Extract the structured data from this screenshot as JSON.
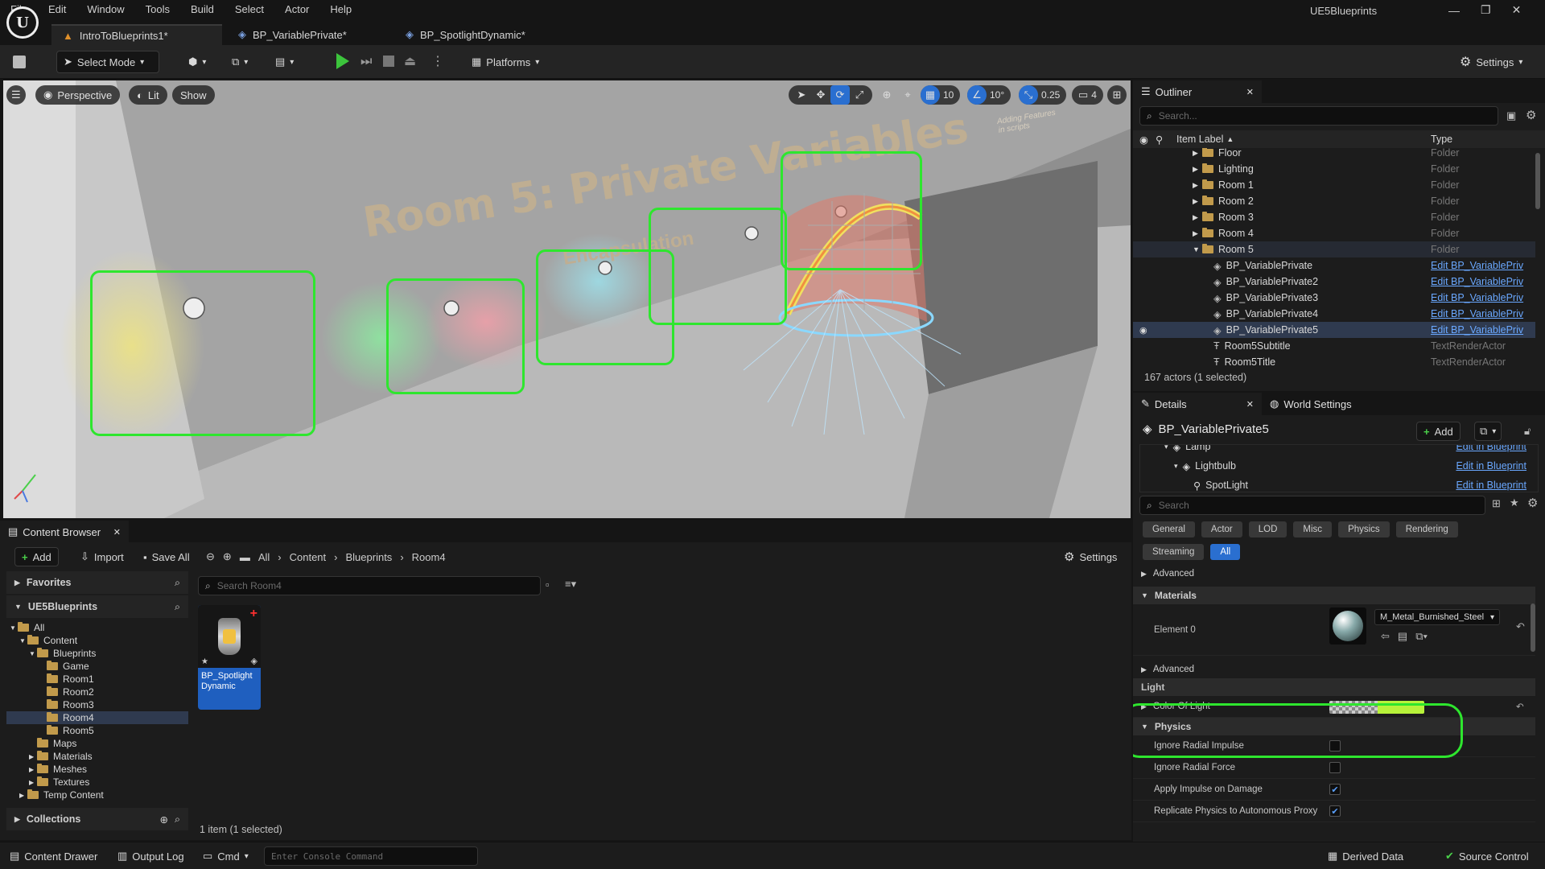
{
  "app": {
    "name": "UE5Blueprints"
  },
  "menu": [
    "File",
    "Edit",
    "Window",
    "Tools",
    "Build",
    "Select",
    "Actor",
    "Help"
  ],
  "doc_tabs": [
    {
      "label": "IntroToBlueprints1*",
      "active": true
    },
    {
      "label": "BP_VariablePrivate*",
      "active": false
    },
    {
      "label": "BP_SpotlightDynamic*",
      "active": false
    }
  ],
  "toolbar": {
    "select_mode": "Select Mode",
    "platforms": "Platforms",
    "settings": "Settings"
  },
  "viewport": {
    "perspective": "Perspective",
    "lit": "Lit",
    "show": "Show",
    "grid_snap": "10",
    "rot_snap": "10°",
    "scale_snap": "0.25",
    "camera_speed": "4",
    "scene_title": "Room 5: Private Variables",
    "scene_subtitle": "Encapsulation",
    "scene_note_1": "Adding Features",
    "scene_note_2": "in scripts"
  },
  "outliner": {
    "tab": "Outliner",
    "search_placeholder": "Search...",
    "col_label": "Item Label",
    "col_type": "Type",
    "rows": [
      {
        "label": "Floor",
        "type": "Folder"
      },
      {
        "label": "Lighting",
        "type": "Folder"
      },
      {
        "label": "Room 1",
        "type": "Folder"
      },
      {
        "label": "Room 2",
        "type": "Folder"
      },
      {
        "label": "Room 3",
        "type": "Folder"
      },
      {
        "label": "Room 4",
        "type": "Folder"
      },
      {
        "label": "Room 5",
        "type": "Folder"
      },
      {
        "label": "BP_VariablePrivate",
        "type": "Edit BP_VariablePriv"
      },
      {
        "label": "BP_VariablePrivate2",
        "type": "Edit BP_VariablePriv"
      },
      {
        "label": "BP_VariablePrivate3",
        "type": "Edit BP_VariablePriv"
      },
      {
        "label": "BP_VariablePrivate4",
        "type": "Edit BP_VariablePriv"
      },
      {
        "label": "BP_VariablePrivate5",
        "type": "Edit BP_VariablePriv"
      },
      {
        "label": "Room5Subtitle",
        "type": "TextRenderActor"
      },
      {
        "label": "Room5Title",
        "type": "TextRenderActor"
      }
    ],
    "footer": "167 actors (1 selected)"
  },
  "details": {
    "tab": "Details",
    "world_tab": "World Settings",
    "actor_name": "BP_VariablePrivate5",
    "add": "Add",
    "components": [
      {
        "label": "Lamp",
        "link": "Edit in Blueprint"
      },
      {
        "label": "Lightbulb",
        "link": "Edit in Blueprint"
      },
      {
        "label": "SpotLight",
        "link": "Edit in Blueprint"
      }
    ],
    "search_placeholder": "Search",
    "filters": [
      "General",
      "Actor",
      "LOD",
      "Misc",
      "Physics",
      "Rendering",
      "Streaming",
      "All"
    ],
    "advanced": "Advanced",
    "materials": "Materials",
    "element0": "Element 0",
    "material_name": "M_Metal_Burnished_Steel",
    "light": "Light",
    "color_of_light": "Color Of Light",
    "light_color": "#b8f23a",
    "physics": "Physics",
    "physics_props": [
      {
        "label": "Ignore Radial Impulse",
        "checked": false
      },
      {
        "label": "Ignore Radial Force",
        "checked": false
      },
      {
        "label": "Apply Impulse on Damage",
        "checked": true
      },
      {
        "label": "Replicate Physics to Autonomous Proxy",
        "checked": true
      }
    ]
  },
  "content_browser": {
    "tab": "Content Browser",
    "add": "Add",
    "import": "Import",
    "save_all": "Save All",
    "breadcrumb": [
      "All",
      "Content",
      "Blueprints",
      "Room4"
    ],
    "settings": "Settings",
    "favorites": "Favorites",
    "project": "UE5Blueprints",
    "tree": [
      "All",
      "Content",
      "Blueprints",
      "Game",
      "Room1",
      "Room2",
      "Room3",
      "Room4",
      "Room5",
      "Maps",
      "Materials",
      "Meshes",
      "Textures",
      "Temp Content"
    ],
    "collections": "Collections",
    "search_placeholder": "Search Room4",
    "asset_name": "BP_Spotlight Dynamic",
    "footer": "1 item (1 selected)"
  },
  "status": {
    "content_drawer": "Content Drawer",
    "output_log": "Output Log",
    "cmd": "Cmd",
    "console_placeholder": "Enter Console Command",
    "derived_data": "Derived Data",
    "source_control": "Source Control"
  }
}
